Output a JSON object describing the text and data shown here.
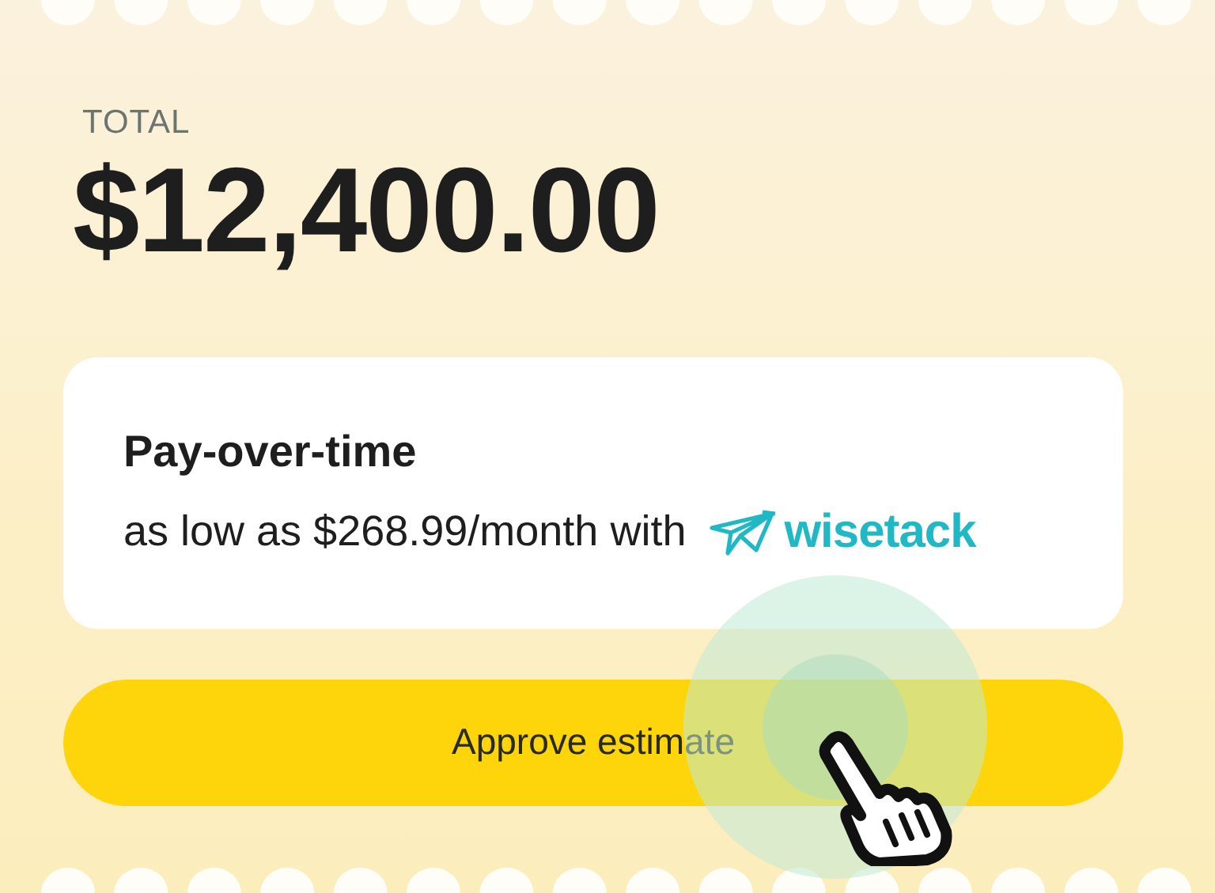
{
  "total": {
    "label": "TOTAL",
    "amount": "$12,400.00"
  },
  "financing": {
    "title": "Pay-over-time",
    "text": "as low as $268.99/month with",
    "brand": "wisetack"
  },
  "button": {
    "label": "Approve estimate"
  }
}
